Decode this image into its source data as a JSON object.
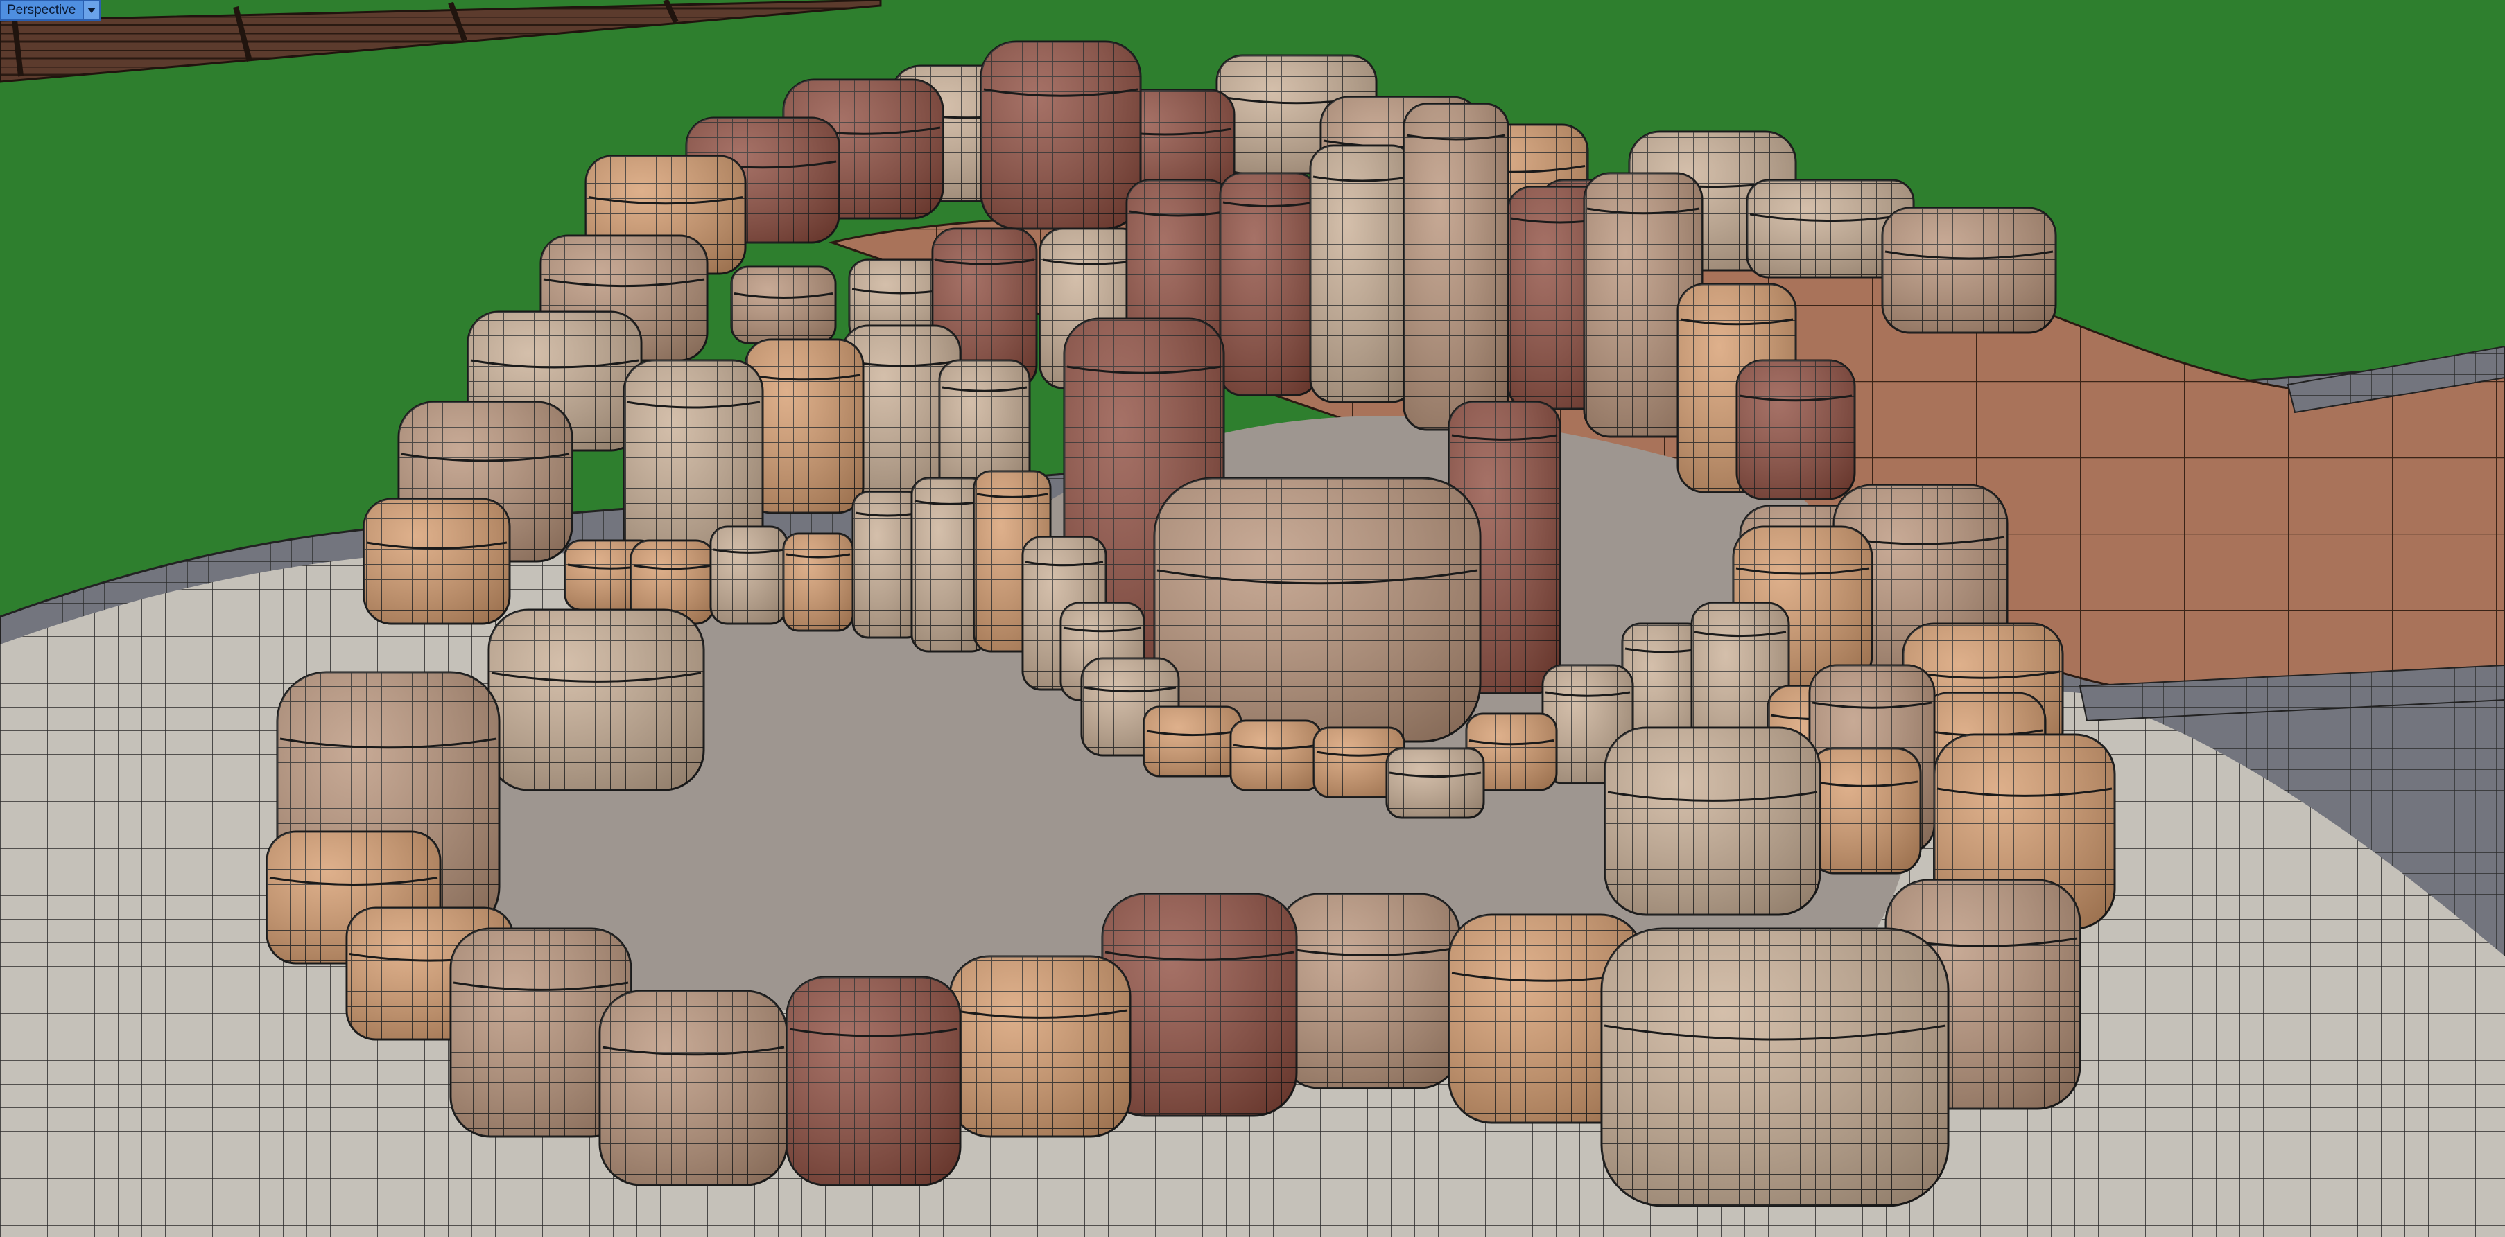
{
  "viewport": {
    "label": "Perspective",
    "menu_icon": "chevron-down-icon"
  },
  "colors": {
    "grass": "#2e7f2e",
    "paving": "#c5c1b9",
    "sand_floor": "#9e9690",
    "path": "#a9735a",
    "curb": "#6d6f78",
    "fence": "#5a3a2c",
    "stone_light": "#c8ad93",
    "stone_orange": "#d59a6b",
    "stone_red": "#8d4a3c",
    "stone_tan": "#b89278",
    "wire": "#1a1a1a"
  }
}
